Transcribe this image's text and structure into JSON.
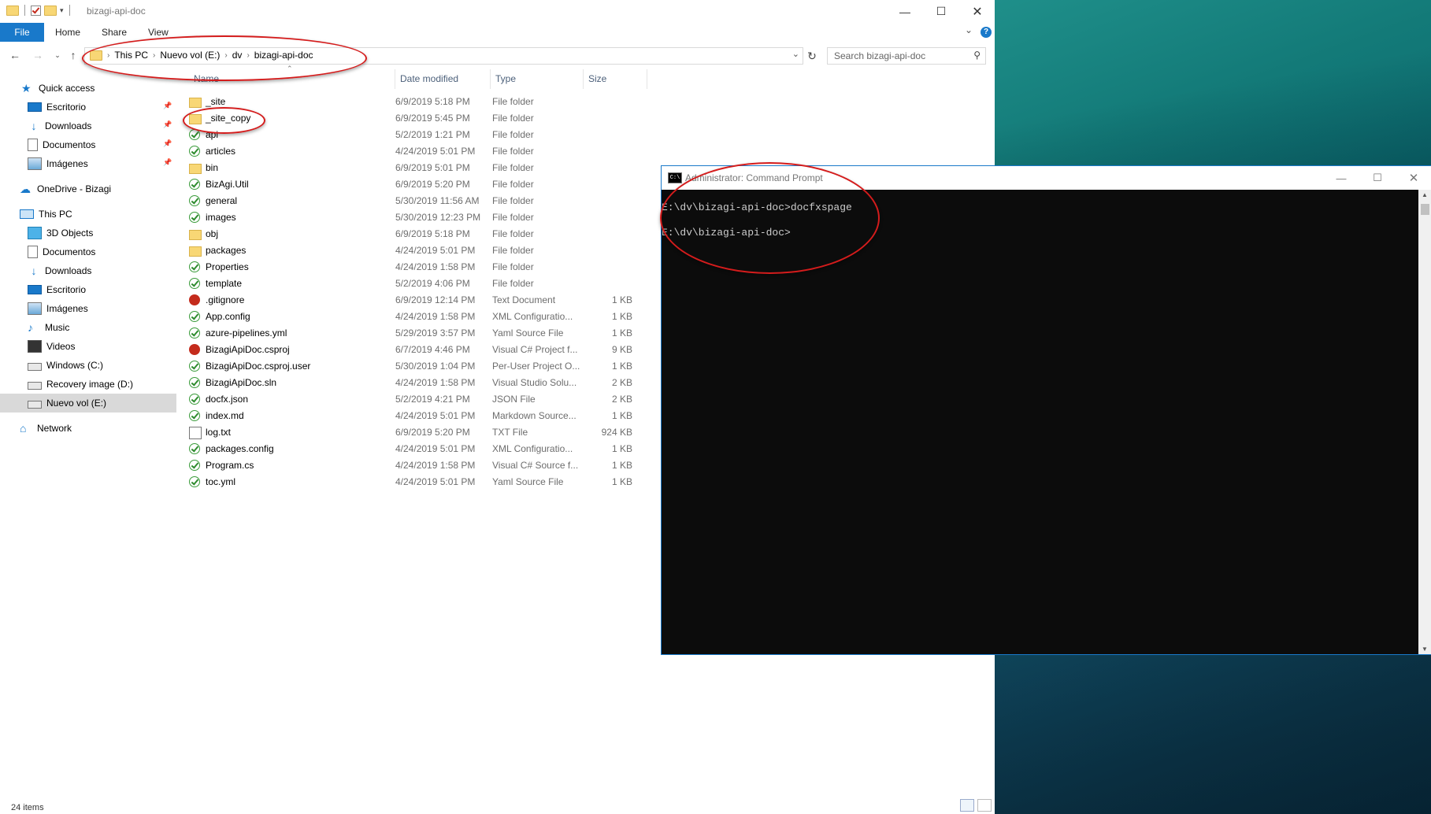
{
  "explorer": {
    "window_title": "bizagi-api-doc",
    "ribbon_tabs": [
      "File",
      "Home",
      "Share",
      "View"
    ],
    "breadcrumbs": [
      "This PC",
      "Nuevo vol (E:)",
      "dv",
      "bizagi-api-doc"
    ],
    "search_placeholder": "Search bizagi-api-doc",
    "columns": [
      "Name",
      "Date modified",
      "Type",
      "Size"
    ],
    "sidebar": [
      {
        "label": "Quick access",
        "icon": "star-icon",
        "pinned": false
      },
      {
        "label": "Escritorio",
        "icon": "desktop-icon",
        "pinned": true
      },
      {
        "label": "Downloads",
        "icon": "download-icon",
        "pinned": true
      },
      {
        "label": "Documentos",
        "icon": "document-icon",
        "pinned": true
      },
      {
        "label": "Imágenes",
        "icon": "pictures-icon",
        "pinned": true
      },
      {
        "label": "OneDrive - Bizagi",
        "icon": "cloud-icon",
        "pinned": false
      },
      {
        "label": "This PC",
        "icon": "computer-icon",
        "pinned": false
      },
      {
        "label": "3D Objects",
        "icon": "cube-icon",
        "pinned": false
      },
      {
        "label": "Documentos",
        "icon": "document-icon",
        "pinned": false
      },
      {
        "label": "Downloads",
        "icon": "download-icon",
        "pinned": false
      },
      {
        "label": "Escritorio",
        "icon": "desktop-icon",
        "pinned": false
      },
      {
        "label": "Imágenes",
        "icon": "pictures-icon",
        "pinned": false
      },
      {
        "label": "Music",
        "icon": "music-icon",
        "pinned": false
      },
      {
        "label": "Videos",
        "icon": "video-icon",
        "pinned": false
      },
      {
        "label": "Windows (C:)",
        "icon": "drive-icon",
        "pinned": false
      },
      {
        "label": "Recovery image (D:)",
        "icon": "drive-icon",
        "pinned": false
      },
      {
        "label": "Nuevo vol (E:)",
        "icon": "drive-icon",
        "pinned": false,
        "selected": true
      },
      {
        "label": "Network",
        "icon": "network-icon",
        "pinned": false
      }
    ],
    "files": [
      {
        "name": "_site",
        "date": "6/9/2019 5:18 PM",
        "type": "File folder",
        "size": "",
        "icon": "folder-icon"
      },
      {
        "name": "_site_copy",
        "date": "6/9/2019 5:45 PM",
        "type": "File folder",
        "size": "",
        "icon": "folder-icon"
      },
      {
        "name": "api",
        "date": "5/2/2019 1:21 PM",
        "type": "File folder",
        "size": "",
        "icon": "synced-folder-icon"
      },
      {
        "name": "articles",
        "date": "4/24/2019 5:01 PM",
        "type": "File folder",
        "size": "",
        "icon": "synced-folder-icon"
      },
      {
        "name": "bin",
        "date": "6/9/2019 5:01 PM",
        "type": "File folder",
        "size": "",
        "icon": "folder-icon"
      },
      {
        "name": "BizAgi.Util",
        "date": "6/9/2019 5:20 PM",
        "type": "File folder",
        "size": "",
        "icon": "synced-folder-icon"
      },
      {
        "name": "general",
        "date": "5/30/2019 11:56 AM",
        "type": "File folder",
        "size": "",
        "icon": "synced-folder-icon"
      },
      {
        "name": "images",
        "date": "5/30/2019 12:23 PM",
        "type": "File folder",
        "size": "",
        "icon": "synced-folder-icon"
      },
      {
        "name": "obj",
        "date": "6/9/2019 5:18 PM",
        "type": "File folder",
        "size": "",
        "icon": "folder-icon"
      },
      {
        "name": "packages",
        "date": "4/24/2019 5:01 PM",
        "type": "File folder",
        "size": "",
        "icon": "folder-icon"
      },
      {
        "name": "Properties",
        "date": "4/24/2019 1:58 PM",
        "type": "File folder",
        "size": "",
        "icon": "synced-folder-icon"
      },
      {
        "name": "template",
        "date": "5/2/2019 4:06 PM",
        "type": "File folder",
        "size": "",
        "icon": "synced-folder-icon"
      },
      {
        "name": ".gitignore",
        "date": "6/9/2019 12:14 PM",
        "type": "Text Document",
        "size": "1 KB",
        "icon": "modified-file-icon"
      },
      {
        "name": "App.config",
        "date": "4/24/2019 1:58 PM",
        "type": "XML Configuratio...",
        "size": "1 KB",
        "icon": "synced-file-icon"
      },
      {
        "name": "azure-pipelines.yml",
        "date": "5/29/2019 3:57 PM",
        "type": "Yaml Source File",
        "size": "1 KB",
        "icon": "synced-file-icon"
      },
      {
        "name": "BizagiApiDoc.csproj",
        "date": "6/7/2019 4:46 PM",
        "type": "Visual C# Project f...",
        "size": "9 KB",
        "icon": "modified-file-icon"
      },
      {
        "name": "BizagiApiDoc.csproj.user",
        "date": "5/30/2019 1:04 PM",
        "type": "Per-User Project O...",
        "size": "1 KB",
        "icon": "synced-file-icon"
      },
      {
        "name": "BizagiApiDoc.sln",
        "date": "4/24/2019 1:58 PM",
        "type": "Visual Studio Solu...",
        "size": "2 KB",
        "icon": "synced-file-icon"
      },
      {
        "name": "docfx.json",
        "date": "5/2/2019 4:21 PM",
        "type": "JSON File",
        "size": "2 KB",
        "icon": "synced-file-icon"
      },
      {
        "name": "index.md",
        "date": "4/24/2019 5:01 PM",
        "type": "Markdown Source...",
        "size": "1 KB",
        "icon": "synced-file-icon"
      },
      {
        "name": "log.txt",
        "date": "6/9/2019 5:20 PM",
        "type": "TXT File",
        "size": "924 KB",
        "icon": "text-file-icon"
      },
      {
        "name": "packages.config",
        "date": "4/24/2019 5:01 PM",
        "type": "XML Configuratio...",
        "size": "1 KB",
        "icon": "synced-file-icon"
      },
      {
        "name": "Program.cs",
        "date": "4/24/2019 1:58 PM",
        "type": "Visual C# Source f...",
        "size": "1 KB",
        "icon": "synced-file-icon"
      },
      {
        "name": "toc.yml",
        "date": "4/24/2019 5:01 PM",
        "type": "Yaml Source File",
        "size": "1 KB",
        "icon": "synced-file-icon"
      }
    ],
    "status": "24 items"
  },
  "cmd": {
    "title": "Administrator: Command Prompt",
    "lines": [
      "E:\\dv\\bizagi-api-doc>docfxspage",
      "E:\\dv\\bizagi-api-doc>"
    ]
  },
  "colors": {
    "accent": "#1979ca",
    "annotation": "#d41c1c",
    "console_bg": "#0c0c0c",
    "console_text": "#cccccc"
  }
}
